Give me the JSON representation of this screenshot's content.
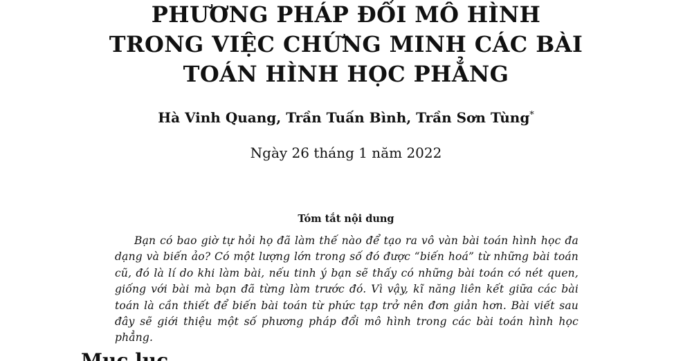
{
  "paper": {
    "title_lines": [
      "PHƯƠNG PHÁP ĐỔI MÔ HÌNH",
      "TRONG VIỆC CHỨNG MINH CÁC BÀI",
      "TOÁN HÌNH HỌC PHẲNG"
    ],
    "authors": "Hà Vinh Quang, Trần Tuấn Bình, Trần Sơn Tùng",
    "author_footnote_mark": "*",
    "date": "Ngày 26 tháng 1 năm 2022",
    "abstract": {
      "heading": "Tóm tắt nội dung",
      "text": "Bạn có bao giờ tự hỏi họ đã làm thế nào để tạo ra vô vàn bài toán hình học đa dạng và biến ảo? Có một lượng lớn trong số đó được “biến hoá” từ những bài toán cũ, đó là lí do khi làm bài, nếu tinh ý bạn sẽ thấy có những bài toán có nét quen, giống với bài mà bạn đã từng làm trước đó. Vì vậy, kĩ năng liên kết giữa các bài toán là cần thiết để biến bài toán từ phức tạp trở nên đơn giản hơn. Bài viết sau đây sẽ giới thiệu một số phương pháp đổi mô hình trong các bài toán hình học phẳng."
    },
    "section_heading": "Mục lục"
  }
}
